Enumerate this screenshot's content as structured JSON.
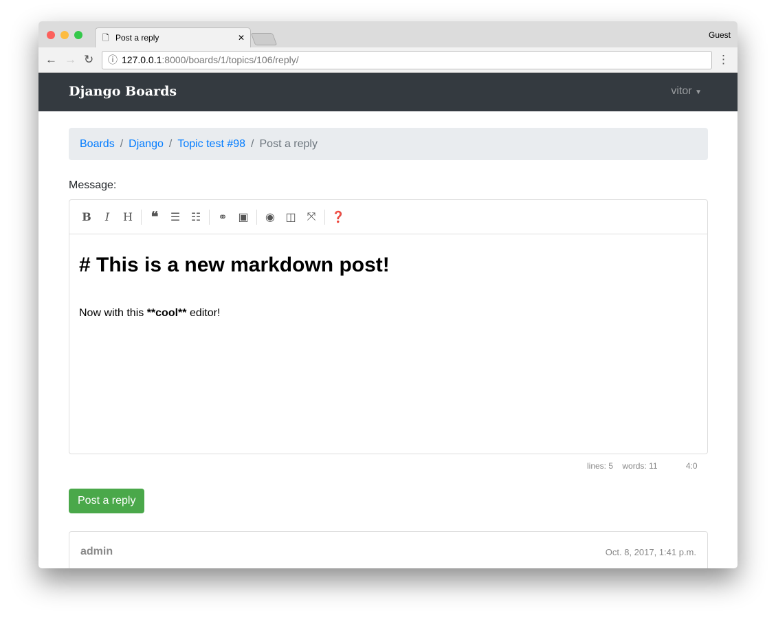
{
  "browser": {
    "tab_title": "Post a reply",
    "profile": "Guest",
    "url_host": "127.0.0.1",
    "url_rest": ":8000/boards/1/topics/106/reply/"
  },
  "navbar": {
    "brand": "Django Boards",
    "user": "vitor"
  },
  "breadcrumb": [
    "Boards",
    "Django",
    "Topic test #98",
    "Post a reply"
  ],
  "form": {
    "label": "Message:",
    "heading": "# This is a new markdown post!",
    "line_pre": "Now with this ",
    "line_bold": "**cool**",
    "line_post": " editor!",
    "status_lines": "lines: 5",
    "status_words": "words: 11",
    "status_cursor": "4:0",
    "submit": "Post a reply"
  },
  "post": {
    "author": "admin",
    "date": "Oct. 8, 2017, 1:41 p.m."
  },
  "colors": {
    "navbar": "#343a40",
    "link": "#007bff",
    "button": "#4aa84a"
  }
}
